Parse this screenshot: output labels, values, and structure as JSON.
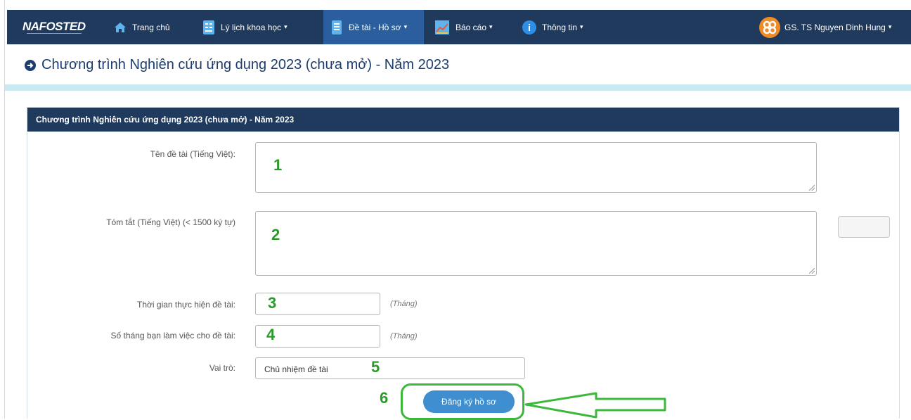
{
  "nav": {
    "logo": "NAFOSTED",
    "home": "Trang chủ",
    "cv": "Lý lịch khoa học",
    "project": "Đề tài - Hồ sơ",
    "report": "Báo cáo",
    "info": "Thông tin",
    "user": "GS. TS Nguyen Dinh Hung"
  },
  "page": {
    "title": "Chương trình Nghiên cứu ứng dụng 2023 (chưa mở) - Năm 2023"
  },
  "panel": {
    "title": "Chương trình Nghiên cứu ứng dụng 2023 (chưa mở) - Năm 2023"
  },
  "form": {
    "title_vi_label": "Tên đề tài (Tiếng Việt):",
    "summary_label": "Tóm tắt (Tiếng Việt) (< 1500 ký tự)",
    "duration_label": "Thời gian thực hiện đề tài:",
    "months_label": "Số tháng bạn làm việc cho đề tài:",
    "role_label": "Vai trò:",
    "unit": "(Tháng)",
    "role_value": "Chủ nhiệm đề tài",
    "submit": "Đăng ký hồ sơ"
  },
  "annotations": [
    "1",
    "2",
    "3",
    "4",
    "5",
    "6"
  ],
  "colors": {
    "navbar": "#1f3a5c",
    "nav_active": "#2a5e9c",
    "button": "#3e8ed0",
    "annotation": "#2a9a2a"
  }
}
